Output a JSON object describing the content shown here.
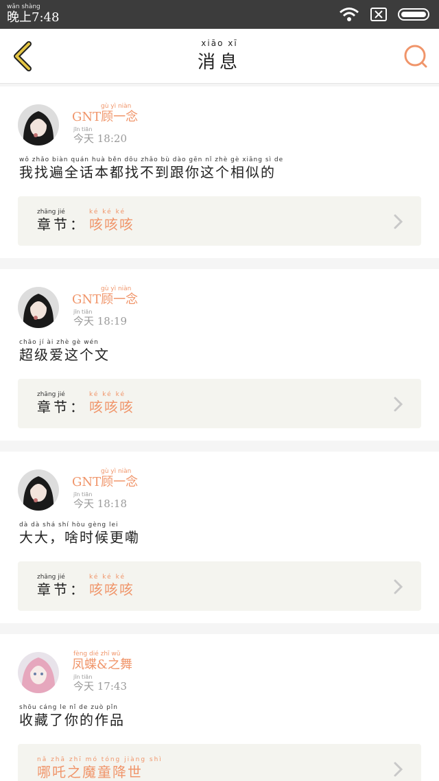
{
  "status": {
    "time_pinyin": "wǎn shàng",
    "time": "晚上7:48"
  },
  "header": {
    "title_pinyin": "xiāo  xī",
    "title": "消息"
  },
  "messages": [
    {
      "name_pinyin": "gù  yì  niàn",
      "name": "GNT顾一念",
      "time_pinyin": "jīn  tiān",
      "time": "今天 18:20",
      "text_pinyin": "wǒ zhǎo biàn quán huà běn dōu zhǎo bù dào gēn nǐ zhè gè xiāng sì de",
      "text": "我找遍全话本都找不到跟你这个相似的",
      "chapter_label_pinyin": "zhāng jié",
      "chapter_label": "章节：",
      "chapter_value_pinyin": "ké  ké  ké",
      "chapter_value": "咳咳咳"
    },
    {
      "name_pinyin": "gù  yì  niàn",
      "name": "GNT顾一念",
      "time_pinyin": "jīn  tiān",
      "time": "今天 18:19",
      "text_pinyin": "chāo jí ài zhè gè wén",
      "text": "超级爱这个文",
      "chapter_label_pinyin": "zhāng jié",
      "chapter_label": "章节：",
      "chapter_value_pinyin": "ké  ké  ké",
      "chapter_value": "咳咳咳"
    },
    {
      "name_pinyin": "gù  yì  niàn",
      "name": "GNT顾一念",
      "time_pinyin": "jīn  tiān",
      "time": "今天 18:18",
      "text_pinyin": "dà dà  shá shí hòu gèng lei",
      "text": "大大，啥时候更嘞",
      "chapter_label_pinyin": "zhāng jié",
      "chapter_label": "章节：",
      "chapter_value_pinyin": "ké  ké  ké",
      "chapter_value": "咳咳咳"
    },
    {
      "name_pinyin": "fèng dié  zhī wǔ",
      "name": "凤蝶&之舞",
      "time_pinyin": "jīn  tiān",
      "time": "今天 17:43",
      "text_pinyin": "shōu cáng le nǐ de zuò pǐn",
      "text": "收藏了你的作品",
      "chapter_label_pinyin": "",
      "chapter_label": "",
      "chapter_value_pinyin": "nǎ zhā zhī mó tóng jiàng shì",
      "chapter_value": "哪吒之魔童降世"
    }
  ],
  "colors": {
    "accent": "#f0956a",
    "back_icon": "#e5c645"
  },
  "icons": {
    "back": "chevron-left-icon",
    "search": "search-icon",
    "chevron": "chevron-right-icon",
    "wifi": "wifi-icon",
    "sim": "no-sim-icon",
    "battery": "battery-icon"
  }
}
